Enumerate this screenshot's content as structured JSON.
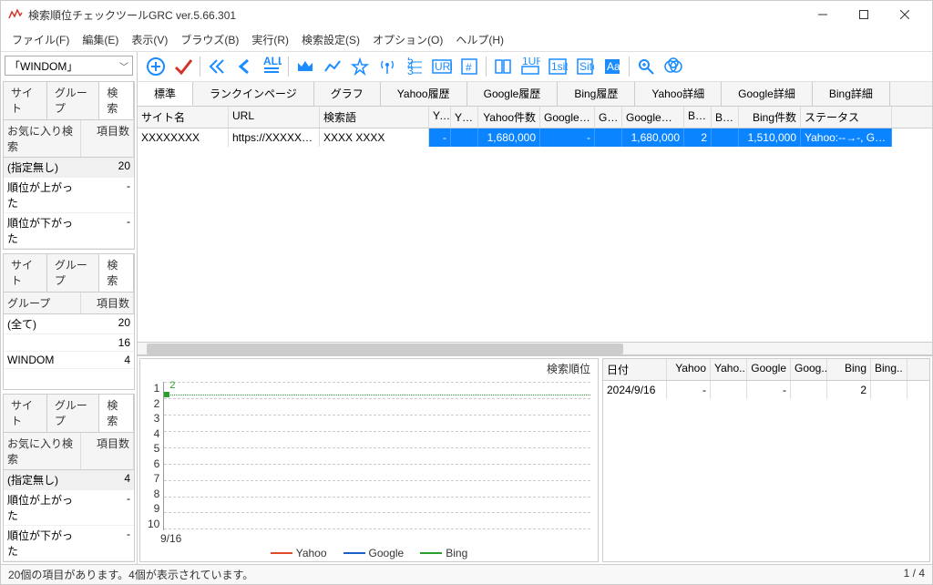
{
  "window": {
    "title": "検索順位チェックツールGRC  ver.5.66.301"
  },
  "menu": [
    "ファイル(F)",
    "編集(E)",
    "表示(V)",
    "ブラウズ(B)",
    "実行(R)",
    "検索設定(S)",
    "オプション(O)",
    "ヘルプ(H)"
  ],
  "combo": {
    "value": "「WINDOM」"
  },
  "left_tabs": [
    "サイト",
    "グループ",
    "検索"
  ],
  "panel1": {
    "headers": [
      "お気に入り検索",
      "項目数"
    ],
    "rows": [
      {
        "label": "(指定無し)",
        "count": "20",
        "sel": true
      },
      {
        "label": "順位が上がった",
        "count": "-"
      },
      {
        "label": "順位が下がった",
        "count": "-"
      }
    ]
  },
  "panel2": {
    "headers": [
      "グループ",
      "項目数"
    ],
    "rows": [
      {
        "label": "(全て)",
        "count": "20"
      },
      {
        "label": "",
        "count": "16"
      },
      {
        "label": "WINDOM",
        "count": "4"
      }
    ]
  },
  "panel3": {
    "headers": [
      "お気に入り検索",
      "項目数"
    ],
    "rows": [
      {
        "label": "(指定無し)",
        "count": "4",
        "sel": true
      },
      {
        "label": "順位が上がった",
        "count": "-"
      },
      {
        "label": "順位が下がった",
        "count": "-"
      }
    ]
  },
  "main_tabs": [
    "標準",
    "ランクインページ",
    "グラフ",
    "Yahoo履歴",
    "Google履歴",
    "Bing履歴",
    "Yahoo詳細",
    "Google詳細",
    "Bing詳細"
  ],
  "grid": {
    "headers": [
      "サイト名",
      "URL",
      "検索語",
      "Ya..",
      "Y変..",
      "Yahoo件数",
      "Google順位",
      "G変..",
      "Google件数",
      "Bin..",
      "B変..",
      "Bing件数",
      "ステータス"
    ],
    "row": {
      "site": "XXXXXXXX",
      "url": "https://XXXXX.XX",
      "kw": "XXXX XXXX",
      "ya": "-",
      "yd": "",
      "yc": "1,680,000",
      "gr": "-",
      "gd": "",
      "gc": "1,680,000",
      "bi": "2",
      "bd": "",
      "bc": "1,510,000",
      "st": "Yahoo:--→-, Goo.."
    }
  },
  "chart_data": {
    "type": "line",
    "title": "検索順位",
    "ylim_ticks": [
      1,
      2,
      3,
      4,
      5,
      6,
      7,
      8,
      9,
      10
    ],
    "x_categories": [
      "9/16"
    ],
    "series": [
      {
        "name": "Yahoo",
        "color": "#e24a2a",
        "values": [
          null
        ]
      },
      {
        "name": "Google",
        "color": "#1a62c9",
        "values": [
          null
        ]
      },
      {
        "name": "Bing",
        "color": "#2a9d2a",
        "values": [
          2
        ]
      }
    ],
    "xlabel": "9/16"
  },
  "datapanel": {
    "headers": [
      "日付",
      "Yahoo",
      "Yaho..",
      "Google",
      "Goog..",
      "Bing",
      "Bing.."
    ],
    "row": {
      "date": "2024/9/16",
      "y": "-",
      "yd": "",
      "g": "-",
      "gd": "",
      "b": "2",
      "bd": ""
    }
  },
  "status": {
    "left": "20個の項目があります。4個が表示されています。",
    "right": "1 / 4"
  },
  "icons": {
    "plus_color": "#1a8cff",
    "check_color": "#d3342a",
    "arrows_color": "#1a8cff",
    "crown_color": "#f5a623"
  }
}
